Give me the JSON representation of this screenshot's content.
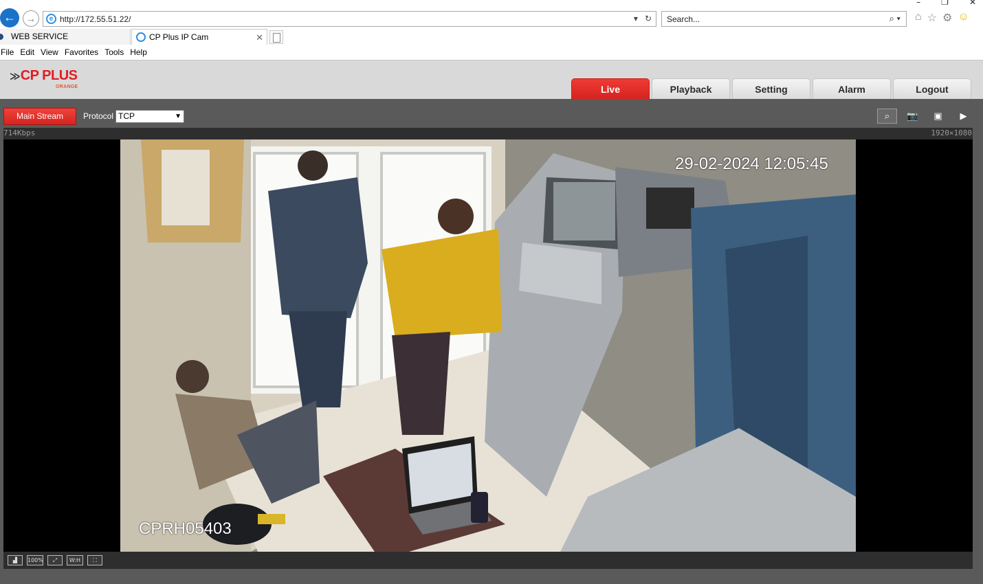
{
  "browser": {
    "window_controls": [
      "–",
      "❐",
      "✕"
    ],
    "url": "http://172.55.51.22/",
    "search_placeholder": "Search...",
    "tabs": [
      {
        "label": "WEB SERVICE"
      },
      {
        "label": "CP Plus IP Cam"
      }
    ],
    "menu": [
      "File",
      "Edit",
      "View",
      "Favorites",
      "Tools",
      "Help"
    ]
  },
  "app": {
    "logo_text": "CP PLUS",
    "logo_sub": "ORANGE",
    "nav": [
      "Live",
      "Playback",
      "Setting",
      "Alarm",
      "Logout"
    ],
    "active_nav": "Live"
  },
  "live": {
    "stream_button": "Main Stream",
    "protocol_label": "Protocol",
    "protocol_value": "TCP",
    "bitrate": "714Kbps",
    "resolution": "1920×1080",
    "timestamp": "29-02-2024 12:05:45",
    "camera_name": "CPRH05403",
    "zoom_label": "100%",
    "wh_label": "W:H"
  },
  "colors": {
    "accent_red": "#e21c23",
    "toolbar_grey": "#5a5a5a"
  }
}
